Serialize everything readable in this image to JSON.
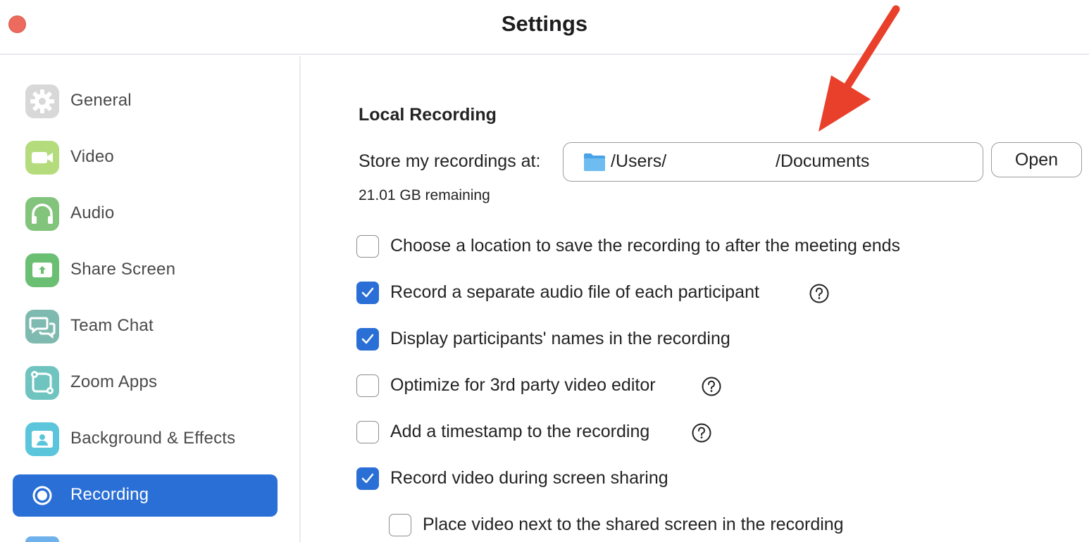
{
  "window": {
    "title": "Settings"
  },
  "sidebar": {
    "items": [
      {
        "label": "General",
        "icon": "gear-icon",
        "color": "#d8d8d8"
      },
      {
        "label": "Video",
        "icon": "video-camera-icon",
        "color": "#b5dc7c"
      },
      {
        "label": "Audio",
        "icon": "headphones-icon",
        "color": "#82c47b"
      },
      {
        "label": "Share Screen",
        "icon": "share-screen-icon",
        "color": "#6bbf73"
      },
      {
        "label": "Team Chat",
        "icon": "chat-bubbles-icon",
        "color": "#7fbab0"
      },
      {
        "label": "Zoom Apps",
        "icon": "apps-icon",
        "color": "#6fc4c0"
      },
      {
        "label": "Background & Effects",
        "icon": "person-background-icon",
        "color": "#5bc6db"
      },
      {
        "label": "Recording",
        "icon": "record-icon",
        "color": "#2a6fd6",
        "active": true
      }
    ]
  },
  "main": {
    "section_title": "Local Recording",
    "store_label": "Store my recordings at:",
    "path_prefix": "/Users/",
    "path_suffix": "/Documents",
    "open_button": "Open",
    "remaining": "21.01 GB remaining",
    "options": [
      {
        "label": "Choose a location to save the recording to after the meeting ends",
        "checked": false,
        "help": false
      },
      {
        "label": "Record a separate audio file of each participant",
        "checked": true,
        "help": true
      },
      {
        "label": "Display participants' names in the recording",
        "checked": true,
        "help": false
      },
      {
        "label": "Optimize for 3rd party video editor",
        "checked": false,
        "help": true
      },
      {
        "label": "Add a timestamp to the recording",
        "checked": false,
        "help": true
      },
      {
        "label": "Record video during screen sharing",
        "checked": true,
        "help": false
      },
      {
        "label": "Place video next to the shared screen in the recording",
        "checked": false,
        "help": false
      }
    ]
  },
  "colors": {
    "accent": "#2a6fd6",
    "annotation_arrow": "#e8402a"
  }
}
